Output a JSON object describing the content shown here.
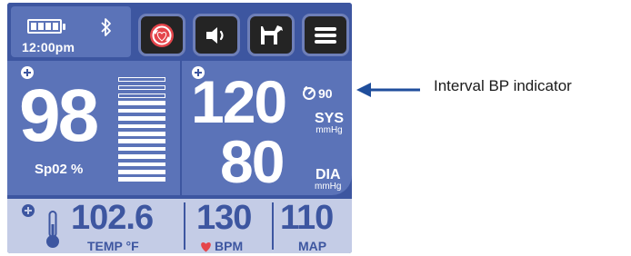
{
  "status": {
    "time": "12:00pm",
    "battery_icon": "battery-full-icon",
    "bluetooth_icon": "bluetooth-icon"
  },
  "toolbar": {
    "buttons": [
      {
        "name": "nibp-start-button",
        "icon": "heart-cycle-icon"
      },
      {
        "name": "volume-button",
        "icon": "speaker-icon"
      },
      {
        "name": "patient-type-button",
        "icon": "dog-icon"
      },
      {
        "name": "menu-button",
        "icon": "hamburger-menu-icon"
      }
    ]
  },
  "spo2": {
    "value": "98",
    "label": "Sp02 %",
    "bar_total": 14,
    "bar_filled": 11
  },
  "bp": {
    "systolic": "120",
    "diastolic": "80",
    "interval": "90",
    "sys_label": "SYS",
    "dia_label": "DIA",
    "unit": "mmHg"
  },
  "bottom": {
    "temp_value": "102.6",
    "temp_label": "TEMP °F",
    "bpm_value": "130",
    "bpm_label": "BPM",
    "map_value": "110",
    "map_label": "MAP"
  },
  "annotation": {
    "text": "Interval BP indicator"
  },
  "colors": {
    "screen_bg": "#3D56A0",
    "panel_bg": "#5B73B8",
    "bottom_bg": "#C4CCE6",
    "heart_red": "#E5454B"
  }
}
